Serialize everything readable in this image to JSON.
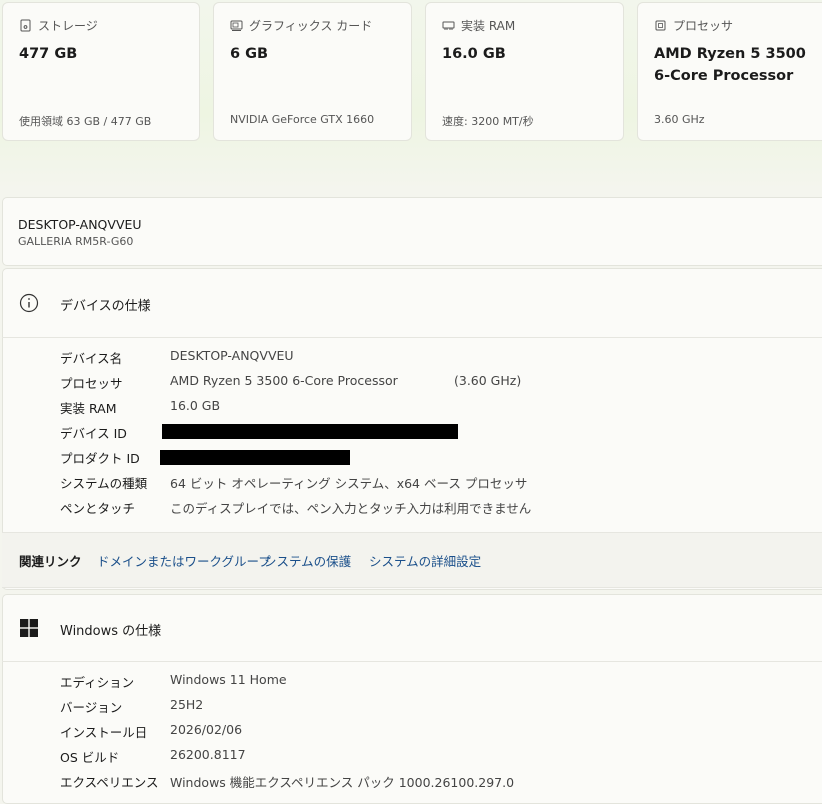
{
  "cards": [
    {
      "title": "ストレージ",
      "value": "477 GB",
      "sub": "使用領域 63 GB / 477 GB",
      "icon": "storage-icon"
    },
    {
      "title": "グラフィックス カード",
      "value": "6 GB",
      "sub": "NVIDIA GeForce GTX 1660",
      "icon": "graphics-card-icon"
    },
    {
      "title": "実装 RAM",
      "value": "16.0 GB",
      "sub": "速度: 3200 MT/秒",
      "icon": "ram-icon"
    },
    {
      "title": "プロセッサ",
      "value": "AMD Ryzen 5 3500 6-Core Processor",
      "sub": "3.60 GHz",
      "icon": "processor-icon"
    }
  ],
  "device": {
    "name": "DESKTOP-ANQVVEU",
    "model": "GALLERIA RM5R-G60"
  },
  "device_specs": {
    "title": "デバイスの仕様",
    "rows": [
      {
        "key": "デバイス名",
        "value": "DESKTOP-ANQVVEU"
      },
      {
        "key": "プロセッサ",
        "value": "AMD Ryzen 5 3500 6-Core Processor",
        "extra": "(3.60 GHz)"
      },
      {
        "key": "実装 RAM",
        "value": "16.0 GB"
      },
      {
        "key": "デバイス ID",
        "value": ""
      },
      {
        "key": "プロダクト ID",
        "value": ""
      },
      {
        "key": "システムの種類",
        "value": "64 ビット オペレーティング システム、x64 ベース プロセッサ"
      },
      {
        "key": "ペンとタッチ",
        "value": "このディスプレイでは、ペン入力とタッチ入力は利用できません"
      }
    ]
  },
  "related_links": {
    "label": "関連リンク",
    "links": [
      "ドメインまたはワークグループ",
      "システムの保護",
      "システムの詳細設定"
    ]
  },
  "windows_specs": {
    "title": "Windows の仕様",
    "rows": [
      {
        "key": "エディション",
        "value": "Windows 11 Home"
      },
      {
        "key": "バージョン",
        "value": "25H2"
      },
      {
        "key": "インストール日",
        "value": "2026/02/06"
      },
      {
        "key": "OS ビルド",
        "value": "26200.8117"
      },
      {
        "key": "エクスペリエンス",
        "value": "Windows 機能エクスペリエンス パック 1000.26100.297.0"
      }
    ]
  }
}
